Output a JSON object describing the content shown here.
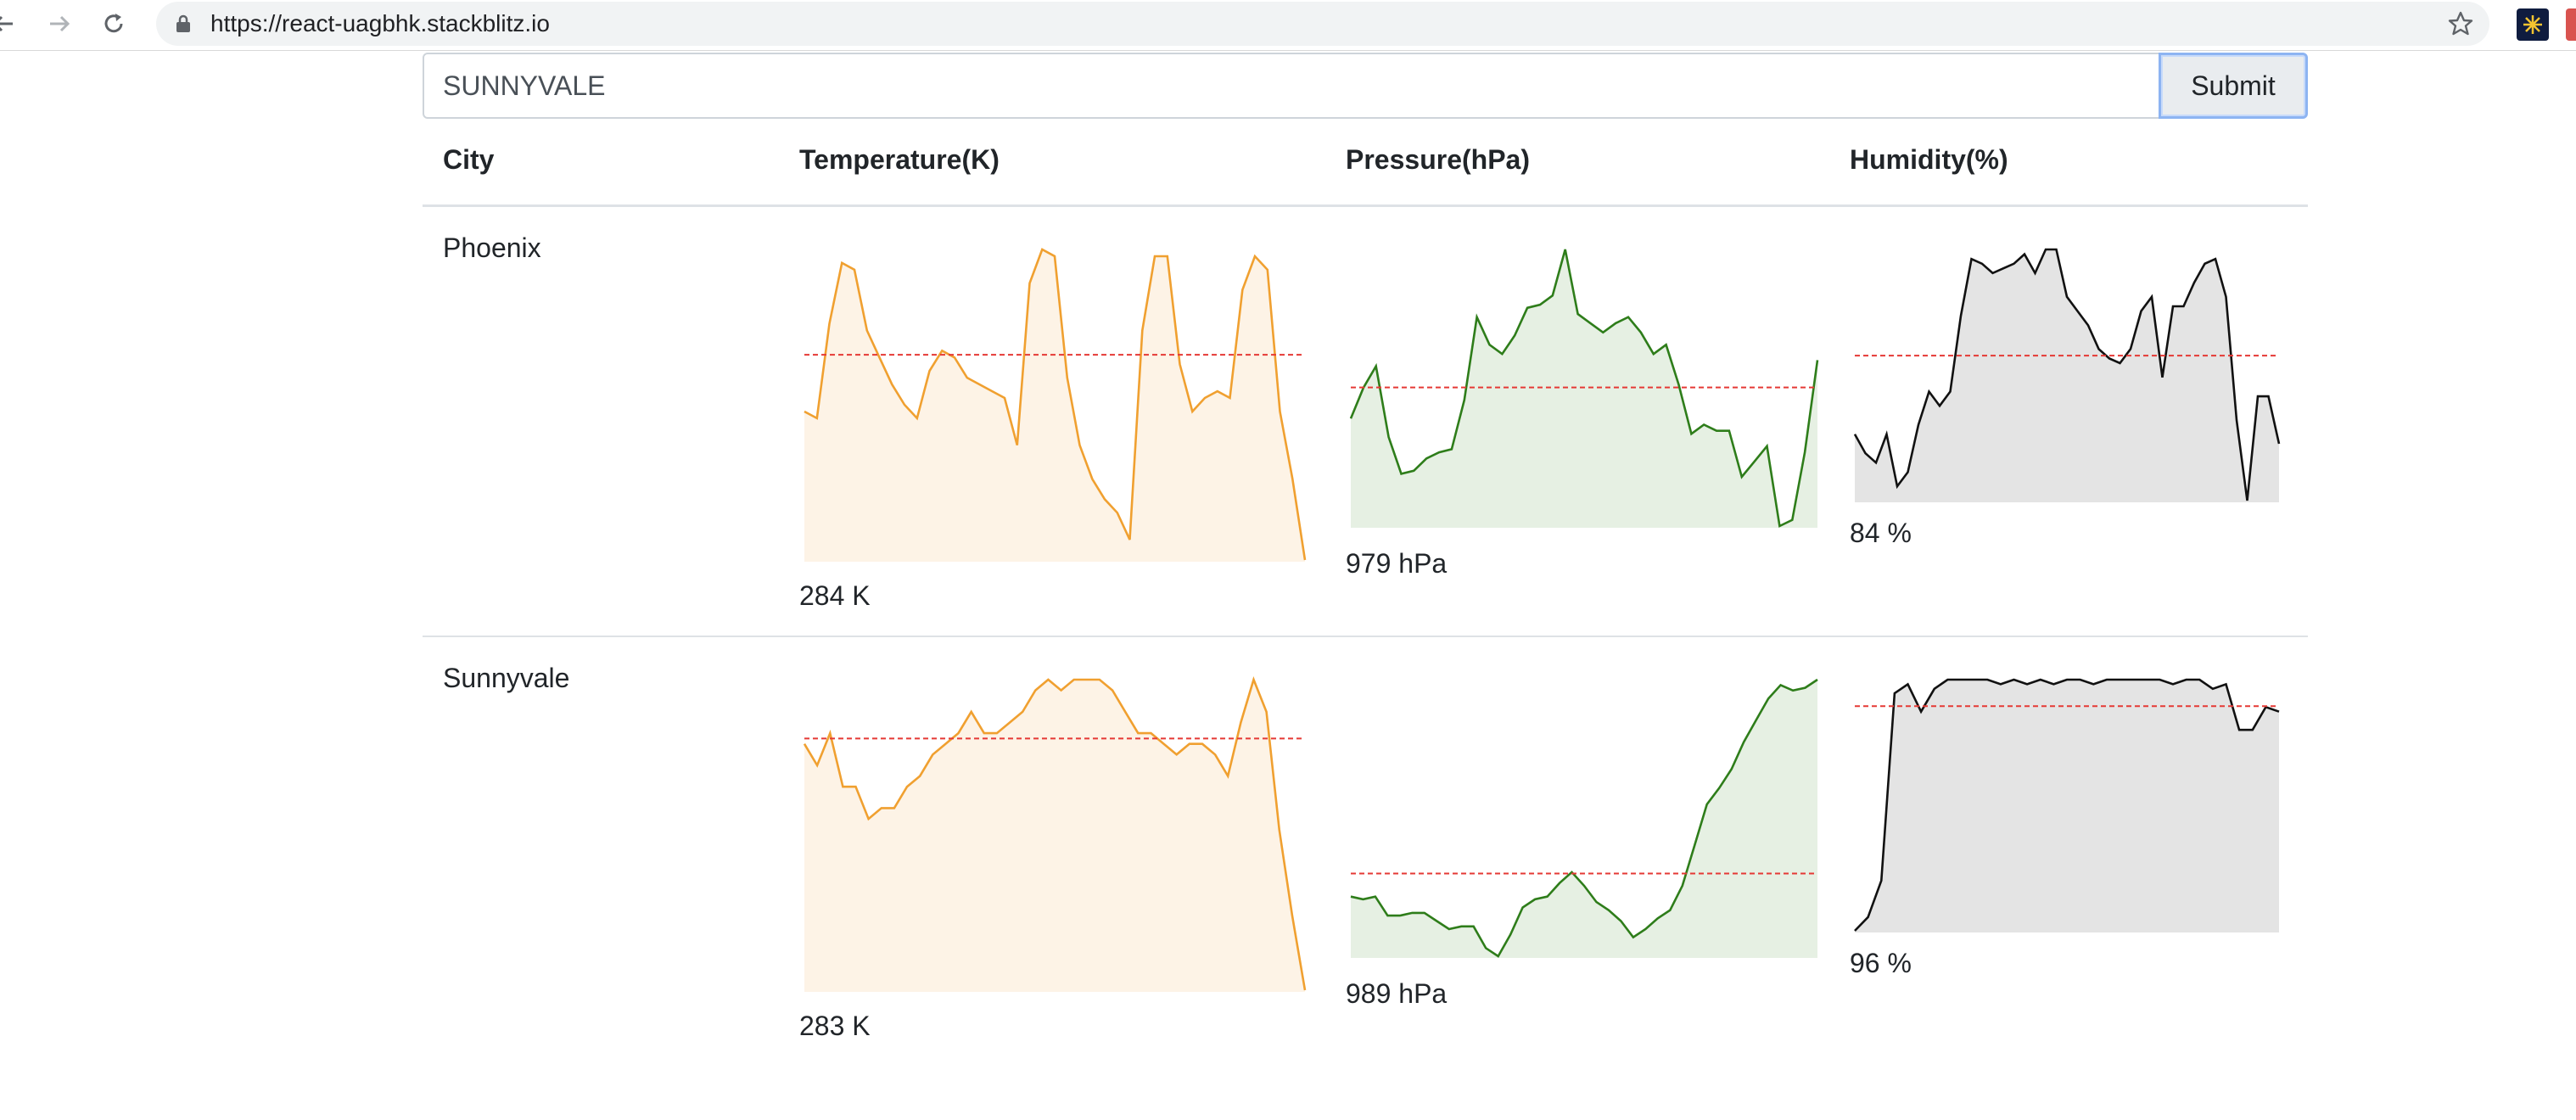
{
  "browser": {
    "url": "https://react-uagbhk.stackblitz.io",
    "icons": [
      "back-arrow-icon",
      "forward-arrow-icon",
      "reload-icon",
      "lock-icon",
      "star-icon",
      "extension-icon"
    ]
  },
  "search": {
    "value": "SUNNYVALE",
    "submit_label": "Submit"
  },
  "table": {
    "headers": {
      "city": "City",
      "temperature": "Temperature(K)",
      "pressure": "Pressure(hPa)",
      "humidity": "Humidity(%)"
    },
    "rows": [
      {
        "city": "Phoenix",
        "temperature_label": "284 K",
        "pressure_label": "979 hPa",
        "humidity_label": "84 %",
        "temperature": [
          272,
          271,
          285,
          294,
          293,
          284,
          280,
          276,
          273,
          271,
          278,
          281,
          280,
          277,
          276,
          275,
          274,
          267,
          291,
          296,
          295,
          277,
          267,
          262,
          259,
          257,
          253,
          284,
          295,
          295,
          279,
          272,
          274,
          275,
          274,
          290,
          295,
          293,
          272,
          262,
          250
        ],
        "pressure": [
          966,
          976,
          983,
          960,
          948,
          949,
          953,
          955,
          956,
          972,
          999,
          990,
          987,
          993,
          1002,
          1003,
          1006,
          1021,
          1000,
          997,
          994,
          997,
          999,
          994,
          987,
          990,
          977,
          961,
          964,
          962,
          962,
          947,
          952,
          957,
          931,
          933,
          955,
          985
        ],
        "humidity": [
          83,
          79,
          77,
          83,
          72,
          75,
          85,
          92,
          89,
          92,
          108,
          120,
          119,
          117,
          118,
          119,
          121,
          117,
          122,
          122,
          112,
          109,
          106,
          101,
          99,
          98,
          101,
          109,
          112,
          95,
          110,
          110,
          115,
          119,
          120,
          112,
          86,
          69,
          91,
          91,
          81
        ],
        "temperature_avg": 280.4,
        "pressure_avg": 976.1,
        "humidity_avg": 99.6
      },
      {
        "city": "Sunnyvale",
        "temperature_label": "283 K",
        "pressure_label": "989 hPa",
        "humidity_label": "96 %",
        "temperature": [
          278,
          276,
          279,
          274,
          274,
          271,
          272,
          272,
          274,
          275,
          277,
          278,
          279,
          281,
          279,
          279,
          280,
          281,
          283,
          284,
          283,
          284,
          284,
          284,
          283,
          281,
          279,
          279,
          278,
          277,
          278,
          278,
          277,
          275,
          280,
          284,
          281,
          270,
          262,
          255
        ],
        "pressure": [
          985,
          984,
          985,
          978,
          978,
          979,
          979,
          976,
          973,
          974,
          974,
          966,
          963,
          971,
          981,
          984,
          985,
          990,
          994,
          989,
          983,
          980,
          976,
          970,
          973,
          977,
          980,
          989,
          1004,
          1019,
          1025,
          1032,
          1042,
          1050,
          1058,
          1063,
          1061,
          1062,
          1065
        ],
        "humidity": [
          60,
          63,
          71,
          112,
          114,
          108,
          113,
          115,
          115,
          115,
          115,
          114,
          115,
          114,
          115,
          114,
          115,
          115,
          114,
          115,
          115,
          115,
          115,
          115,
          114,
          115,
          115,
          113,
          114,
          104,
          104,
          109,
          108
        ],
        "temperature_avg": 278.5,
        "pressure_avg": 993.5,
        "humidity_avg": 109.2
      }
    ]
  },
  "colors": {
    "temperature": "#f0a030",
    "temperature_fill": "#fdf3e6",
    "pressure": "#2e7d1a",
    "pressure_fill": "#e6f0e3",
    "humidity": "#111111",
    "humidity_fill": "#e4e4e4",
    "average_line": "#e53935"
  }
}
